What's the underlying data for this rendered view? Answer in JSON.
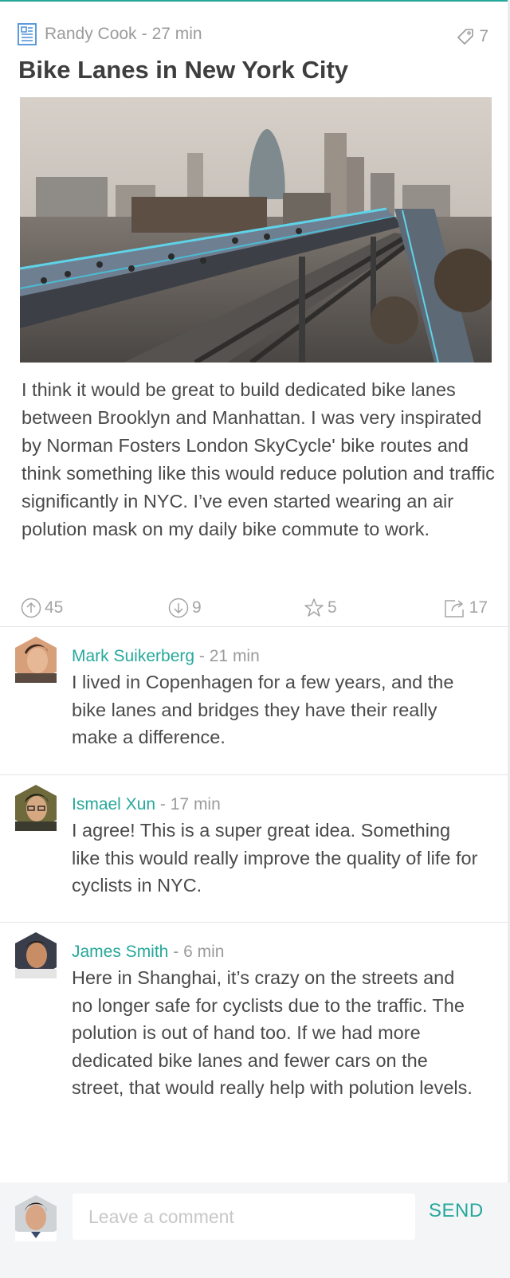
{
  "post": {
    "author": "Randy Cook",
    "separator": "-",
    "time": "27 min",
    "tag_count": "7",
    "title": "Bike Lanes in New York City",
    "body": "I think it would be great to build dedicated bike lanes between Brooklyn and Manhattan. I was very inspirated by Norman Fosters London SkyCycle' bike routes and think something like this would reduce polution and traffic significantly in NYC. I’ve even started wearing an air polution mask on my daily bike commute to work.",
    "actions": {
      "upvotes": "45",
      "downvotes": "9",
      "stars": "5",
      "shares": "17"
    }
  },
  "comments": [
    {
      "name": "Mark Suikerberg",
      "separator": "-",
      "time": "21 min",
      "text": "I lived in Copenhagen for a few years, and the bike lanes and bridges they have their really make a difference."
    },
    {
      "name": "Ismael Xun",
      "separator": "-",
      "time": "17 min",
      "text": "I agree! This is a super great idea. Something like this would really improve the quality of life for cyclists in NYC."
    },
    {
      "name": "James Smith",
      "separator": "-",
      "time": "6 min",
      "text": "Here in Shanghai, it’s crazy on the streets and no longer safe for cyclists due to the traffic. The polution is out of hand too. If we had more dedicated bike lanes and fewer cars on the street, that would really help with polution levels."
    }
  ],
  "composer": {
    "placeholder": "Leave a comment",
    "send_label": "SEND"
  },
  "icons": {
    "post_type": "document-icon",
    "tag": "tag-icon",
    "upvote": "arrow-up-circle-icon",
    "downvote": "arrow-down-circle-icon",
    "star": "star-icon",
    "share": "share-icon"
  },
  "colors": {
    "accent": "#26a89b",
    "muted_text": "#9b9b9b",
    "body_text": "#4a4a4a",
    "footer_bg": "#f3f5f7"
  }
}
